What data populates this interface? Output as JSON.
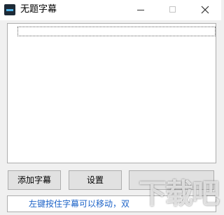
{
  "window": {
    "title": "无题字幕",
    "icon": "app-icon",
    "controls": {
      "minimize_icon": "minimize-icon",
      "maximize_icon": "maximize-icon",
      "close_icon": "close-icon"
    }
  },
  "list": {
    "items": []
  },
  "buttons": {
    "add_subtitle": "添加字幕",
    "settings": "设置",
    "third": ""
  },
  "status": {
    "text": "左键按住字幕可以移动，双"
  },
  "watermark": {
    "text": "下载吧"
  }
}
